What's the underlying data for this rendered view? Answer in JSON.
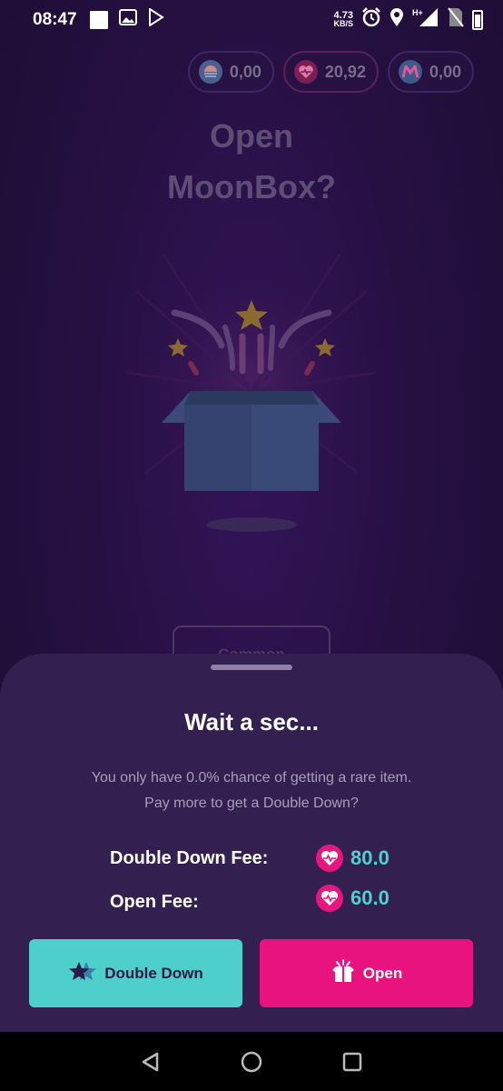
{
  "status_bar": {
    "time": "08:47",
    "net_speed_value": "4.73",
    "net_speed_unit": "KB/S",
    "network": "H+"
  },
  "currencies": [
    {
      "value": "0,00",
      "icon": "moon-coin-icon",
      "color": "#3c6fb0"
    },
    {
      "value": "20,92",
      "icon": "heart-coin-icon",
      "color": "#e6177f"
    },
    {
      "value": "0,00",
      "icon": "m-coin-icon",
      "color": "#3c6fb0"
    }
  ],
  "main": {
    "title_line1": "Open",
    "title_line2": "MoonBox?",
    "rarity_label": "Common"
  },
  "sheet": {
    "title": "Wait a sec...",
    "message_line1": "You only have 0.0% chance of getting a rare item.",
    "message_line2": "Pay more to get a Double Down?",
    "double_down_fee_label": "Double Down Fee:",
    "double_down_fee_value": "80.0",
    "open_fee_label": "Open Fee:",
    "open_fee_value": "60.0",
    "double_down_button": "Double Down",
    "open_button": "Open"
  },
  "colors": {
    "accent_pink": "#e8137e",
    "accent_teal": "#4fcfcb",
    "sheet_bg": "#342050"
  }
}
